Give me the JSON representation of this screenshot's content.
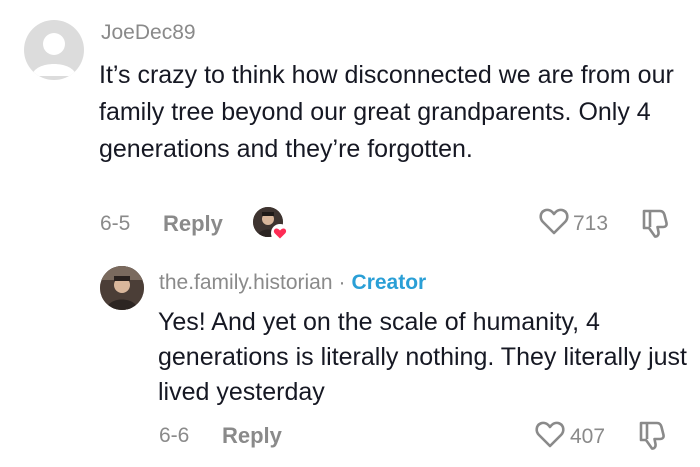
{
  "comment": {
    "username": "JoeDec89",
    "text": "It’s crazy to think how disconnected we are from our family tree beyond our great grandparents. Only 4 generations and they’re forgotten.",
    "date": "6-5",
    "reply_label": "Reply",
    "like_count": "713",
    "avatar_icon": "default-avatar-icon",
    "creator_liked_icon": "creator-liked-heart-icon"
  },
  "reply": {
    "username": "the.family.historian",
    "separator": "·",
    "badge": "Creator",
    "text": "Yes! And yet on the scale of humanity, 4 generations is literally nothing. They literally just lived yesterday",
    "date": "6-6",
    "reply_label": "Reply",
    "like_count": "407"
  },
  "colors": {
    "creator_badge": "#2a9fd6",
    "heart_badge": "#fe2c55",
    "text": "#161823",
    "muted": "#8a8a8a"
  }
}
